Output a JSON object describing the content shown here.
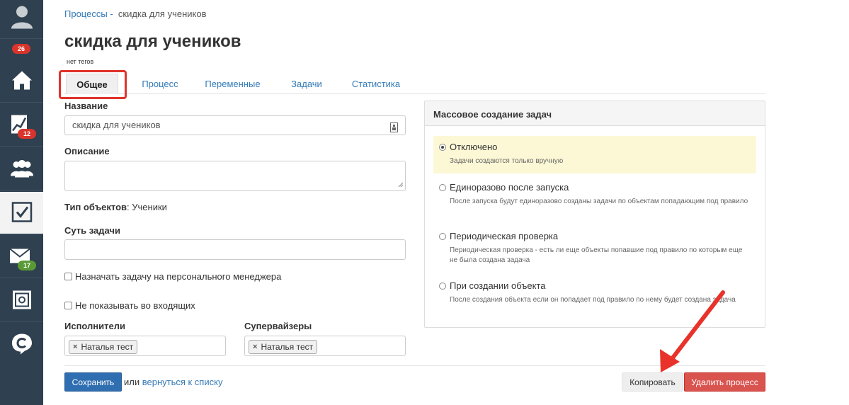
{
  "sidebar": {
    "badges": {
      "profile": "26",
      "analytics": "12",
      "mail": "17"
    }
  },
  "breadcrumb": {
    "parent": "Процессы",
    "separator": "-",
    "current": "скидка для учеников"
  },
  "title": "скидка для учеников",
  "tags": "нет тегов",
  "tabs": [
    {
      "label": "Общее"
    },
    {
      "label": "Процесс"
    },
    {
      "label": "Переменные"
    },
    {
      "label": "Задачи"
    },
    {
      "label": "Статистика"
    }
  ],
  "form": {
    "name_label": "Название",
    "name_value": "скидка для учеников",
    "description_label": "Описание",
    "object_type_label": "Тип объектов",
    "object_type_value": ": Ученики",
    "task_essence_label": "Суть задачи",
    "assign_personal_manager": "Назначать задачу на персонального менеджера",
    "hide_in_inbox": "Не показывать во входящих",
    "executors_label": "Исполнители",
    "executor_token": "Наталья тест",
    "supervisors_label": "Супервайзеры",
    "supervisor_token": "Наталья тест"
  },
  "mass_panel": {
    "title": "Массовое создание задач",
    "options": [
      {
        "title": "Отключено",
        "desc": "Задачи создаются только вручную",
        "selected": true
      },
      {
        "title": "Единоразово после запуска",
        "desc": "После запуска будут единоразово созданы задачи по объектам попадающим под правило",
        "selected": false
      },
      {
        "title": "Периодическая проверка",
        "desc": "Периодическая проверка - есть ли еще объекты попавшие под правило по которым еще не была создана задача",
        "selected": false
      },
      {
        "title": "При создании объекта",
        "desc": "После создания объекта если он попадает под правило по нему будет создана задача",
        "selected": false
      }
    ]
  },
  "footer": {
    "save": "Сохранить",
    "or": "или",
    "back_link": "вернуться к списку",
    "copy": "Копировать",
    "delete": "Удалить процесс"
  },
  "colors": {
    "sidebar": "#2f4050",
    "primary": "#2f6eb0",
    "danger": "#d9534f",
    "highlight": "#e0332a"
  }
}
